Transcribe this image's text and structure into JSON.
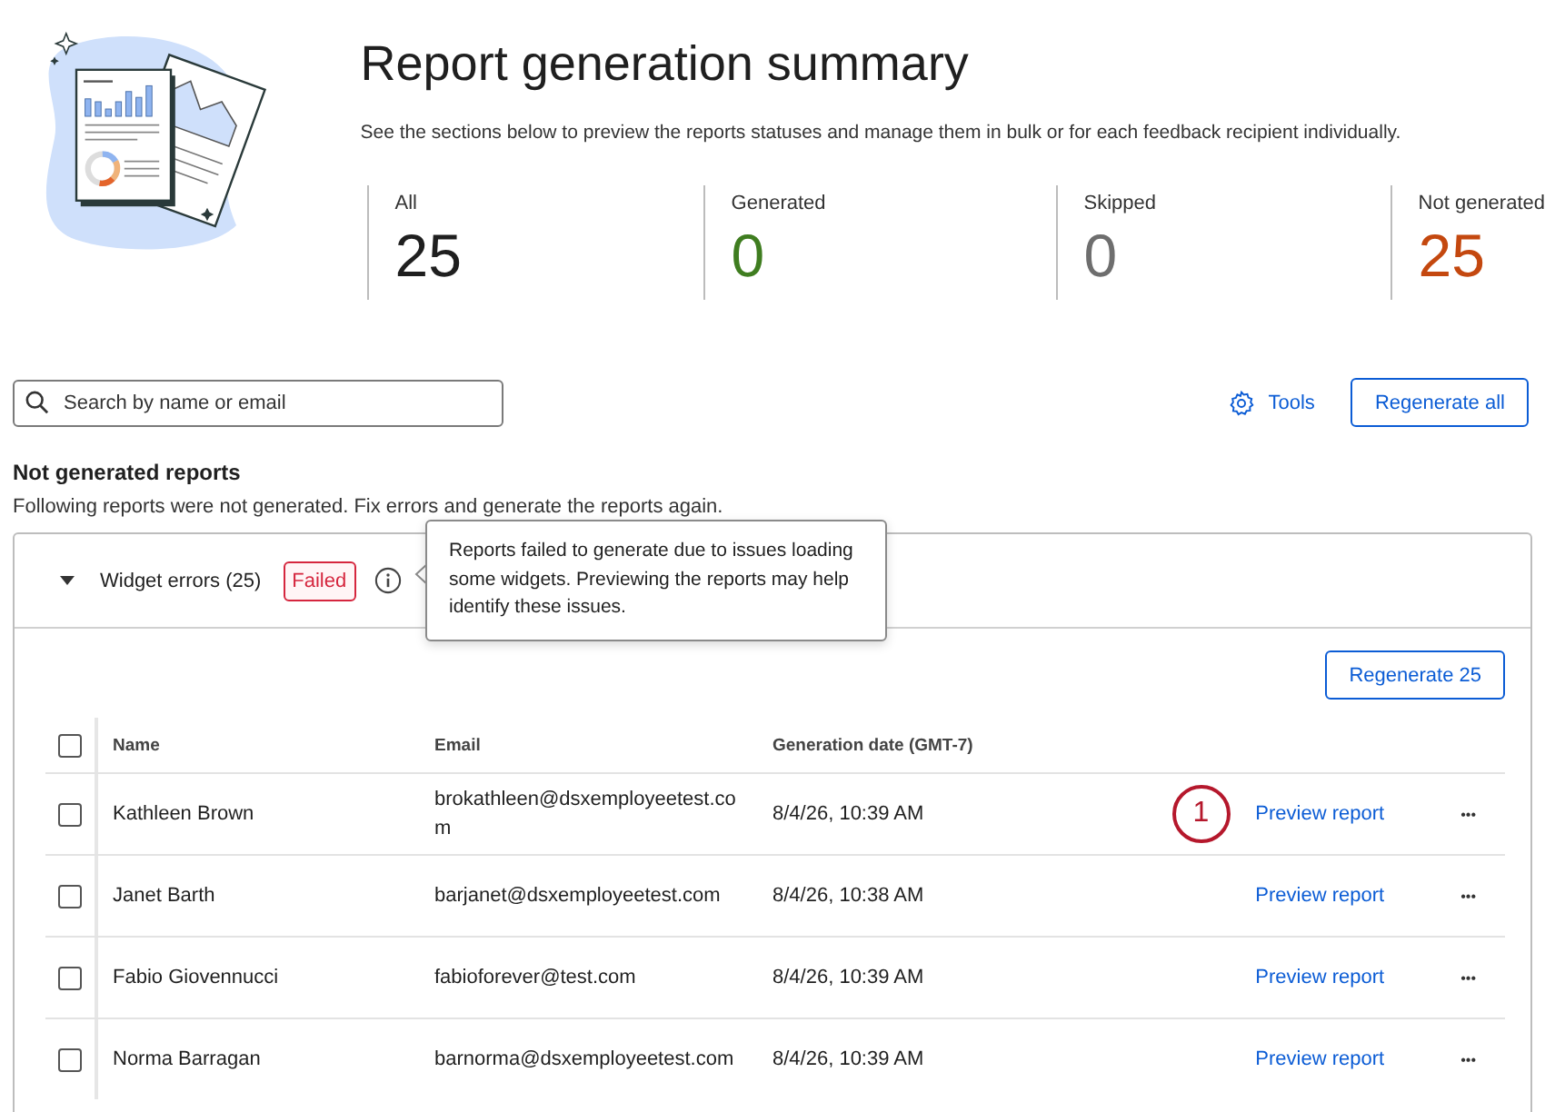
{
  "title": "Report generation summary",
  "subtitle": "See the sections below to preview the reports statuses and manage them in bulk or for each feedback recipient individually.",
  "stats": [
    {
      "label": "All",
      "value": "25",
      "kind": "all"
    },
    {
      "label": "Generated",
      "value": "0",
      "kind": "generated"
    },
    {
      "label": "Skipped",
      "value": "0",
      "kind": "skipped"
    },
    {
      "label": "Not generated",
      "value": "25",
      "kind": "not_generated"
    }
  ],
  "search": {
    "placeholder": "Search by name or email"
  },
  "tools_button": "Tools",
  "regenerate_all_button": "Regenerate all",
  "section": {
    "title": "Not generated reports",
    "description": "Following reports were not generated. Fix errors and generate the reports again."
  },
  "panel": {
    "title": "Widget errors (25)",
    "expanded": true,
    "badge": "Failed",
    "tooltip": "Reports failed to generate due to issues loading some widgets. Previewing the reports may help identify these issues.",
    "regenerate_button": "Regenerate 25"
  },
  "table": {
    "select_all": {
      "checked": false
    },
    "columns": [
      "Name",
      "Email",
      "Generation date (GMT-7)"
    ],
    "rows": [
      {
        "checked": false,
        "name": "Kathleen Brown",
        "email": "brokathleen@dsxemployeetest.com",
        "date": "8/4/26, 10:39 AM",
        "annotation": "1",
        "action": "Preview report",
        "more": "•••"
      },
      {
        "checked": false,
        "name": "Janet Barth",
        "email": "barjanet@dsxemployeetest.com",
        "date": "8/4/26, 10:38 AM",
        "action": "Preview report",
        "more": "•••"
      },
      {
        "checked": false,
        "name": "Fabio Giovennucci",
        "email": "fabioforever@test.com",
        "date": "8/4/26, 10:39 AM",
        "action": "Preview report",
        "more": "•••"
      },
      {
        "checked": false,
        "name": "Norma Barragan",
        "email": "barnorma@dsxemployeetest.com",
        "date": "8/4/26, 10:39 AM",
        "action": "Preview report",
        "more": "•••"
      }
    ]
  }
}
